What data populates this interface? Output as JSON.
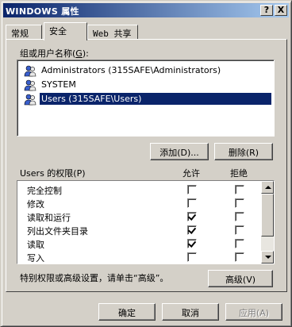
{
  "window": {
    "title": "WINDOWS 属性",
    "help_label": "?",
    "close_label": "X"
  },
  "tabs": [
    {
      "label": "常规",
      "active": false
    },
    {
      "label": "安全",
      "active": true
    },
    {
      "label": "Web 共享",
      "active": false
    }
  ],
  "users": {
    "label_prefix": "组或用户名称(",
    "label_key": "G",
    "label_suffix": "):",
    "items": [
      {
        "name": "Administrators (315SAFE\\Administrators)",
        "icon": "user-group-icon",
        "selected": false
      },
      {
        "name": "SYSTEM",
        "icon": "user-group-icon",
        "selected": false
      },
      {
        "name": "Users (315SAFE\\Users)",
        "icon": "user-group-icon",
        "selected": true
      }
    ],
    "add_label": "添加(D)...",
    "remove_label": "删除(R)"
  },
  "permissions": {
    "title": "Users 的权限(P)",
    "allow_header": "允许",
    "deny_header": "拒绝",
    "rows": [
      {
        "name": "完全控制",
        "allow": false,
        "deny": false
      },
      {
        "name": "修改",
        "allow": false,
        "deny": false
      },
      {
        "name": "读取和运行",
        "allow": true,
        "deny": false
      },
      {
        "name": "列出文件夹目录",
        "allow": true,
        "deny": false
      },
      {
        "name": "读取",
        "allow": true,
        "deny": false
      },
      {
        "name": "写入",
        "allow": false,
        "deny": false
      }
    ]
  },
  "advanced": {
    "hint": "特别权限或高级设置，请单击“高级”。",
    "button_label": "高级(V)"
  },
  "footer": {
    "ok_label": "确定",
    "cancel_label": "取消",
    "apply_label": "应用(A)"
  },
  "colors": {
    "title_start": "#0a246a",
    "title_end": "#a6caf0",
    "selection": "#0a246a",
    "face": "#d4d0c8"
  }
}
